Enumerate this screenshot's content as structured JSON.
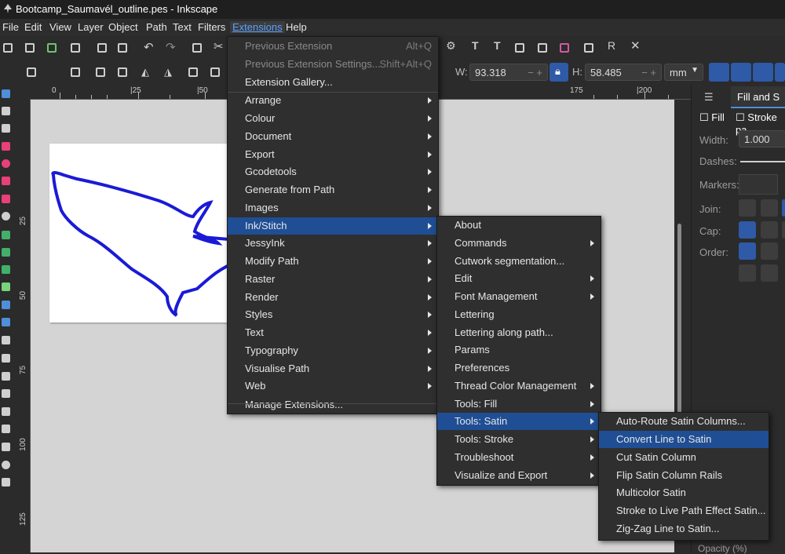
{
  "window": {
    "title": "Bootcamp_Saumavél_outline.pes - Inkscape"
  },
  "menubar": [
    "File",
    "Edit",
    "View",
    "Layer",
    "Object",
    "Path",
    "Text",
    "Filters",
    "Extensions",
    "Help"
  ],
  "ctrl": {
    "w_label": "W:",
    "w_value": "93.318",
    "h_label": "H:",
    "h_value": "58.485",
    "unit": "mm"
  },
  "ruler": {
    "h": [
      "0",
      "|25",
      "|50",
      "175",
      "|200"
    ],
    "v": [
      "25",
      "50",
      "75",
      "100",
      "125"
    ]
  },
  "right_panel": {
    "tab": "Fill and S",
    "fill": "Fill",
    "stroke_paint": "Stroke pa",
    "width_label": "Width:",
    "width_value": "1.000",
    "dashes": "Dashes:",
    "markers": "Markers:",
    "join": "Join:",
    "cap": "Cap:",
    "order": "Order:",
    "opacity": "Opacity (%)"
  },
  "extensions_menu": [
    {
      "label": "Previous Extension",
      "shortcut": "Alt+Q",
      "disabled": true
    },
    {
      "label": "Previous Extension Settings...",
      "shortcut": "Shift+Alt+Q",
      "disabled": true
    },
    {
      "label": "Extension Gallery..."
    },
    {
      "label": "Arrange",
      "sub": true
    },
    {
      "label": "Colour",
      "sub": true
    },
    {
      "label": "Document",
      "sub": true
    },
    {
      "label": "Export",
      "sub": true
    },
    {
      "label": "Gcodetools",
      "sub": true
    },
    {
      "label": "Generate from Path",
      "sub": true
    },
    {
      "label": "Images",
      "sub": true
    },
    {
      "label": "Ink/Stitch",
      "sub": true,
      "highlight": true
    },
    {
      "label": "JessyInk",
      "sub": true
    },
    {
      "label": "Modify Path",
      "sub": true
    },
    {
      "label": "Raster",
      "sub": true
    },
    {
      "label": "Render",
      "sub": true
    },
    {
      "label": "Styles",
      "sub": true
    },
    {
      "label": "Text",
      "sub": true
    },
    {
      "label": "Typography",
      "sub": true
    },
    {
      "label": "Visualise Path",
      "sub": true
    },
    {
      "label": "Web",
      "sub": true
    },
    {
      "label": "Manage Extensions..."
    }
  ],
  "inkstitch_menu": [
    {
      "label": "About"
    },
    {
      "label": "Commands",
      "sub": true
    },
    {
      "label": "Cutwork segmentation..."
    },
    {
      "label": "Edit",
      "sub": true
    },
    {
      "label": "Font Management",
      "sub": true
    },
    {
      "label": "Lettering"
    },
    {
      "label": "Lettering along path..."
    },
    {
      "label": "Params"
    },
    {
      "label": "Preferences"
    },
    {
      "label": "Thread Color Management",
      "sub": true
    },
    {
      "label": "Tools: Fill",
      "sub": true
    },
    {
      "label": "Tools: Satin",
      "sub": true,
      "highlight": true
    },
    {
      "label": "Tools: Stroke",
      "sub": true
    },
    {
      "label": "Troubleshoot",
      "sub": true
    },
    {
      "label": "Visualize and Export",
      "sub": true
    }
  ],
  "satin_menu": [
    {
      "label": "Auto-Route Satin Columns..."
    },
    {
      "label": "Convert Line to Satin",
      "highlight": true
    },
    {
      "label": "Cut Satin Column"
    },
    {
      "label": "Flip Satin Column Rails"
    },
    {
      "label": "Multicolor Satin"
    },
    {
      "label": "Stroke to Live Path Effect Satin..."
    },
    {
      "label": "Zig-Zag Line to Satin..."
    }
  ],
  "colors": {
    "highlight": "#1f4e94",
    "outline": "#1a1ad6",
    "accent": "#2e5aa7"
  }
}
